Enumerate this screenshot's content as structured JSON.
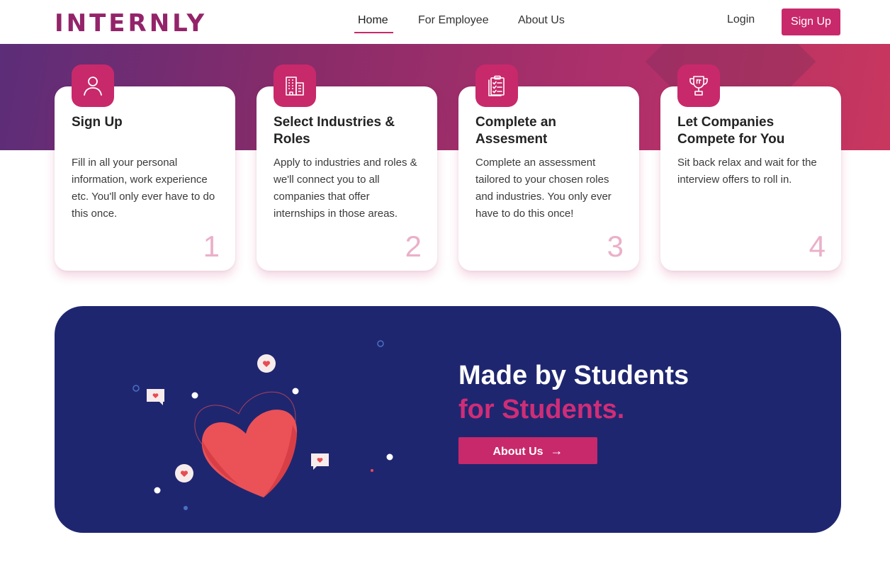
{
  "brand": {
    "logo": "INTERNLY",
    "accent": "#c8296b",
    "logo_color": "#93246a",
    "banner_bg": "#1f2670"
  },
  "nav": {
    "links": [
      "Home",
      "For Employee",
      "About Us"
    ],
    "active": "Home",
    "login": "Login",
    "signup": "Sign Up"
  },
  "steps": [
    {
      "icon": "user-icon",
      "title": "Sign Up",
      "text": "Fill in all your personal information, work experience etc. You'll only ever have to do this once.",
      "number": "1"
    },
    {
      "icon": "building-icon",
      "title": "Select Industries & Roles",
      "text": "Apply to industries and roles & we'll connect you to all companies that offer internships in those areas.",
      "number": "2"
    },
    {
      "icon": "clipboard-checklist-icon",
      "title": "Complete an Assesment",
      "text": "Complete an assessment tailored to your chosen roles and industries. You only ever have to do this once!",
      "number": "3"
    },
    {
      "icon": "trophy-icon",
      "title": "Let Companies Compete for You",
      "text": "Sit back relax and wait for the interview offers to roll in.",
      "number": "4"
    }
  ],
  "banner": {
    "line1": "Made by Students",
    "line2": "for Students.",
    "button": "About Us",
    "button_arrow": "→"
  }
}
